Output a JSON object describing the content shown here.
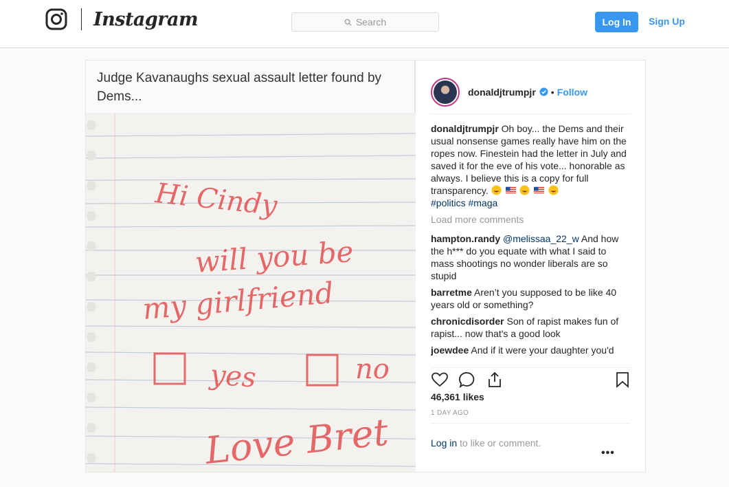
{
  "nav": {
    "brand": "Instagram",
    "search_placeholder": "Search",
    "login_label": "Log In",
    "signup_label": "Sign Up"
  },
  "post": {
    "image_caption": "Judge Kavanaughs sexual assault letter found by Dems...",
    "note_lines": [
      "Hi Cindy",
      "will you be",
      "my girlfriend",
      "yes",
      "no",
      "Love Bret"
    ],
    "author": "donaldjtrumpjr",
    "follow_label": "Follow",
    "caption_text": "Oh boy... the Dems and their usual nonsense games really have him on the ropes now. Finestein had the letter in July and saved it for the eve of his vote... honorable as always. I believe this is a copy for full transparency.",
    "hashtags": [
      "#politics",
      "#maga"
    ],
    "load_more_label": "Load more comments",
    "comments": [
      {
        "user": "hampton.randy",
        "mention": "@melissaa_22_w",
        "text": "And how the h*** do you equate with what I said to mass shootings no wonder liberals are so stupid"
      },
      {
        "user": "barretme",
        "mention": "",
        "text": "Aren’t you supposed to be like 40 years old or something?"
      },
      {
        "user": "chronicdisorder",
        "mention": "",
        "text": "Son of rapist makes fun of rapist... now that's a good look"
      },
      {
        "user": "joewdee",
        "mention": "",
        "text": "And if it were your daughter you'd probably have the same reaction"
      }
    ],
    "likes": "46,361 likes",
    "time_ago": "1 DAY AGO",
    "login_link": "Log in",
    "login_rest": " to like or comment."
  },
  "colors": {
    "accent": "#3897f0",
    "link_dark": "#003569",
    "ink": "#e04a4a"
  },
  "icons": [
    "instagram-logo-icon",
    "search-icon",
    "verified-badge-icon",
    "heart-icon",
    "comment-icon",
    "share-icon",
    "bookmark-icon",
    "more-options-icon"
  ]
}
